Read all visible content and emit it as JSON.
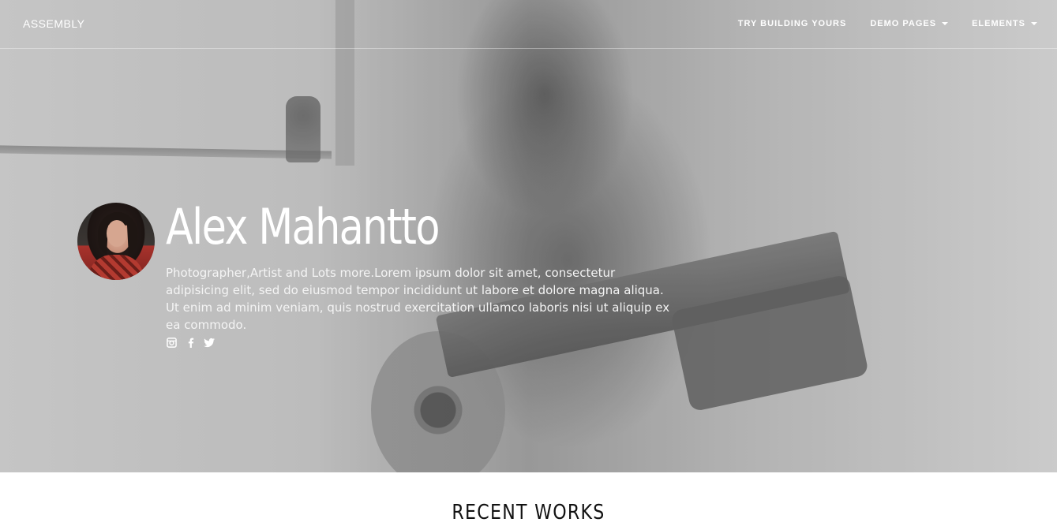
{
  "navbar": {
    "brand": "ASSEMBLY",
    "links": [
      {
        "label": "TRY BUILDING YOURS",
        "dropdown": false
      },
      {
        "label": "DEMO PAGES",
        "dropdown": true
      },
      {
        "label": "ELEMENTS",
        "dropdown": true
      }
    ]
  },
  "hero": {
    "name": "Alex Mahantto",
    "description": "Photographer,Artist and Lots more.Lorem ipsum dolor sit amet, consectetur adipisicing elit, sed do eiusmod tempor incididunt ut labore et dolore magna aliqua. Ut enim ad minim veniam, quis nostrud exercitation ullamco laboris nisi ut aliquip ex ea commodo.",
    "social": [
      "instagram-icon",
      "facebook-icon",
      "twitter-icon"
    ]
  },
  "recent_works": {
    "title": "RECENT WORKS"
  },
  "colors": {
    "text_on_hero": "#ffffff",
    "page_background": "#ffffff",
    "heading": "#111111"
  }
}
